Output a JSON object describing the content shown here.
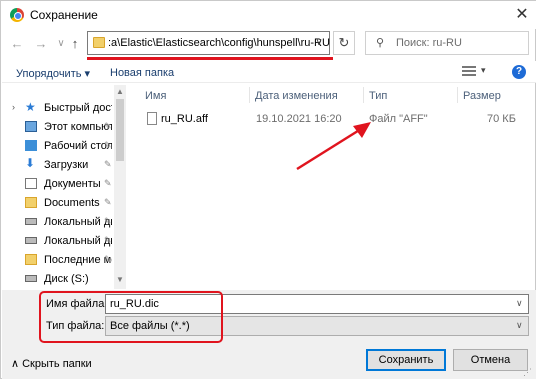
{
  "window": {
    "title": "Сохранение",
    "close_glyph": "✕"
  },
  "nav": {
    "back": "←",
    "forward": "→",
    "up": "↑",
    "address": ":a\\Elastic\\Elasticsearch\\config\\hunspell\\ru-RU",
    "address_drop": "∨",
    "refresh": "↻"
  },
  "search": {
    "icon": "search-icon",
    "placeholder": "Поиск: ru-RU"
  },
  "toolbar": {
    "organize": "Упорядочить ▾",
    "new_folder": "Новая папка",
    "help": "?"
  },
  "sidebar": {
    "items": [
      {
        "label": "Быстрый доступ",
        "icon": "star-icon"
      },
      {
        "label": "Этот компьютер",
        "icon": "computer-icon"
      },
      {
        "label": "Рабочий стол",
        "icon": "desktop-icon"
      },
      {
        "label": "Загрузки",
        "icon": "downloads-icon"
      },
      {
        "label": "Документы",
        "icon": "documents-icon"
      },
      {
        "label": "Documents",
        "icon": "folder-icon"
      },
      {
        "label": "Локальный диск",
        "icon": "drive-icon"
      },
      {
        "label": "Локальный диск",
        "icon": "drive-icon"
      },
      {
        "label": "Последние места",
        "icon": "folder-icon"
      },
      {
        "label": "Диск (S:)",
        "icon": "drive-icon"
      }
    ]
  },
  "columns": {
    "name": "Имя",
    "date": "Дата изменения",
    "type": "Тип",
    "size": "Размер"
  },
  "files": [
    {
      "name": "ru_RU.aff",
      "date": "19.10.2021 16:20",
      "type": "Файл \"AFF\"",
      "size": "70 КБ"
    }
  ],
  "form": {
    "filename_label": "Имя файла:",
    "filename_value": "ru_RU.dic",
    "filetype_label": "Тип файла:",
    "filetype_value": "Все файлы (*.*)"
  },
  "footer": {
    "hide_folders": "Скрыть папки",
    "save": "Сохранить",
    "cancel": "Отмена"
  },
  "colors": {
    "annotation": "#e0141e",
    "accent": "#0078d7"
  }
}
